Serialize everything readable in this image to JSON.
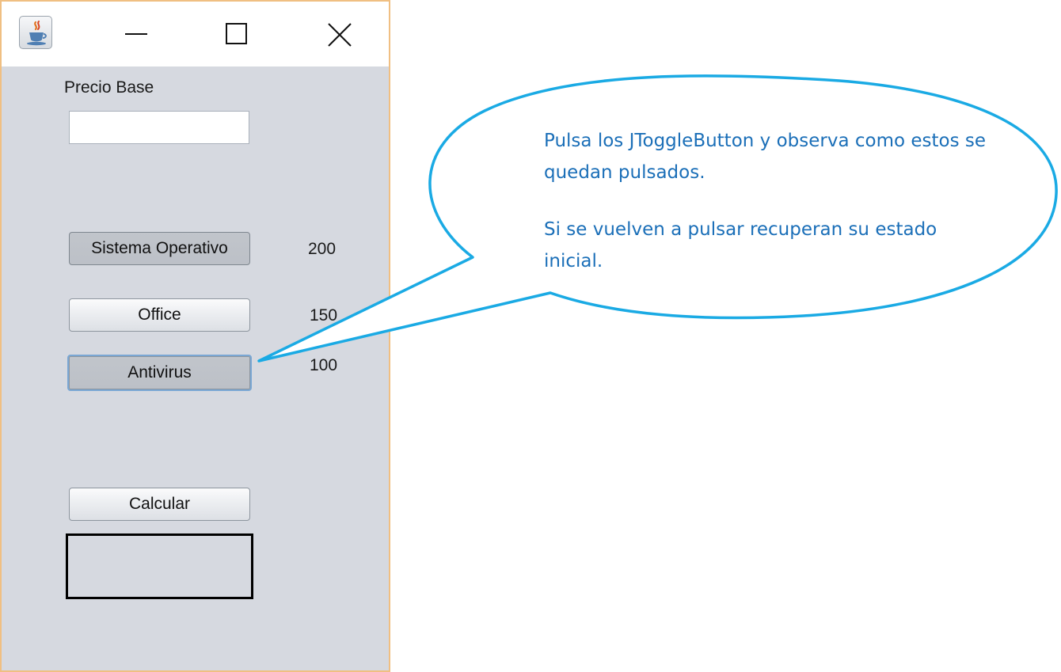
{
  "window": {
    "controls": {
      "minimize": "minimize-icon",
      "maximize": "maximize-icon",
      "close": "close-icon",
      "app_icon": "java-coffee-cup-icon"
    },
    "border_color": "#f0bf82",
    "background_color": "#d6d9e0"
  },
  "form": {
    "precio_base_label": "Precio Base",
    "precio_base_value": "",
    "toggles": [
      {
        "label": "Sistema Operativo",
        "price": "200",
        "selected": true
      },
      {
        "label": "Office",
        "price": "150",
        "selected": false
      },
      {
        "label": "Antivirus",
        "price": "100",
        "selected": true,
        "focused": true
      }
    ],
    "calcular_label": "Calcular",
    "result_value": ""
  },
  "callout": {
    "line1": "Pulsa los JToggleButton y observa como estos se quedan pulsados.",
    "line2": "Si se vuelven a pulsar recuperan su estado inicial.",
    "text_color": "#1b6fb8",
    "outline_color": "#1aaae4"
  }
}
